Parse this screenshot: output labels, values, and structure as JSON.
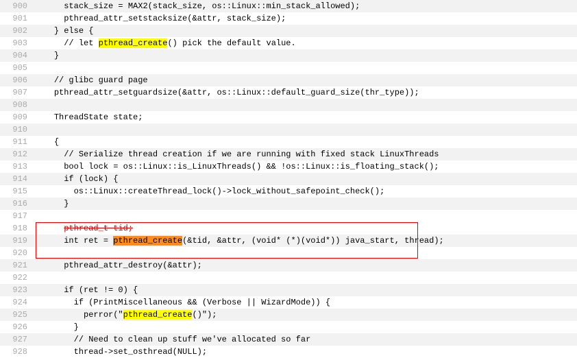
{
  "lines": [
    {
      "no": "900",
      "indent": "      ",
      "segments": [
        {
          "t": "stack_size = MAX2(stack_size, os::Linux::min_stack_allowed);"
        }
      ]
    },
    {
      "no": "901",
      "indent": "      ",
      "segments": [
        {
          "t": "pthread_attr_setstacksize(&attr, stack_size);"
        }
      ]
    },
    {
      "no": "902",
      "indent": "    ",
      "segments": [
        {
          "t": "} else {"
        }
      ]
    },
    {
      "no": "903",
      "indent": "      ",
      "segments": [
        {
          "t": "// let "
        },
        {
          "t": "pthread_create",
          "cls": "hl-yellow"
        },
        {
          "t": "() pick the default value."
        }
      ]
    },
    {
      "no": "904",
      "indent": "    ",
      "segments": [
        {
          "t": "}"
        }
      ]
    },
    {
      "no": "905",
      "indent": "",
      "segments": []
    },
    {
      "no": "906",
      "indent": "    ",
      "segments": [
        {
          "t": "// glibc guard page"
        }
      ]
    },
    {
      "no": "907",
      "indent": "    ",
      "segments": [
        {
          "t": "pthread_attr_setguardsize(&attr, os::Linux::default_guard_size(thr_type));"
        }
      ]
    },
    {
      "no": "908",
      "indent": "",
      "segments": []
    },
    {
      "no": "909",
      "indent": "    ",
      "segments": [
        {
          "t": "ThreadState state;"
        }
      ]
    },
    {
      "no": "910",
      "indent": "",
      "segments": []
    },
    {
      "no": "911",
      "indent": "    ",
      "segments": [
        {
          "t": "{"
        }
      ]
    },
    {
      "no": "912",
      "indent": "      ",
      "segments": [
        {
          "t": "// Serialize thread creation if we are running with fixed stack LinuxThreads"
        }
      ]
    },
    {
      "no": "913",
      "indent": "      ",
      "segments": [
        {
          "t": "bool lock = os::Linux::is_LinuxThreads() && !os::Linux::is_floating_stack();"
        }
      ]
    },
    {
      "no": "914",
      "indent": "      ",
      "segments": [
        {
          "t": "if (lock) {"
        }
      ]
    },
    {
      "no": "915",
      "indent": "        ",
      "segments": [
        {
          "t": "os::Linux::createThread_lock()->lock_without_safepoint_check();"
        }
      ]
    },
    {
      "no": "916",
      "indent": "      ",
      "segments": [
        {
          "t": "}"
        }
      ]
    },
    {
      "no": "917",
      "indent": "",
      "segments": []
    },
    {
      "no": "918",
      "indent": "      ",
      "segments": [
        {
          "t": "pthread_t tid;",
          "cls": "strike"
        }
      ],
      "boxed": true
    },
    {
      "no": "919",
      "indent": "      ",
      "segments": [
        {
          "t": "int ret = "
        },
        {
          "t": "pthread_create",
          "cls": "hl-orange"
        },
        {
          "t": "(&tid, &attr, (void* (*)(void*)) java_start, thread);"
        }
      ],
      "boxed": true
    },
    {
      "no": "920",
      "indent": "",
      "segments": [],
      "boxed": true
    },
    {
      "no": "921",
      "indent": "      ",
      "segments": [
        {
          "t": "pthread_attr_destroy(&attr);"
        }
      ]
    },
    {
      "no": "922",
      "indent": "",
      "segments": []
    },
    {
      "no": "923",
      "indent": "      ",
      "segments": [
        {
          "t": "if (ret != 0) {"
        }
      ]
    },
    {
      "no": "924",
      "indent": "        ",
      "segments": [
        {
          "t": "if (PrintMiscellaneous && (Verbose || WizardMode)) {"
        }
      ]
    },
    {
      "no": "925",
      "indent": "          ",
      "segments": [
        {
          "t": "perror(\""
        },
        {
          "t": "pthread_create",
          "cls": "hl-yellow"
        },
        {
          "t": "()\");"
        }
      ]
    },
    {
      "no": "926",
      "indent": "        ",
      "segments": [
        {
          "t": "}"
        }
      ]
    },
    {
      "no": "927",
      "indent": "        ",
      "segments": [
        {
          "t": "// Need to clean up stuff we've allocated so far"
        }
      ]
    },
    {
      "no": "928",
      "indent": "        ",
      "segments": [
        {
          "t": "thread->set_osthread(NULL);"
        }
      ]
    }
  ]
}
